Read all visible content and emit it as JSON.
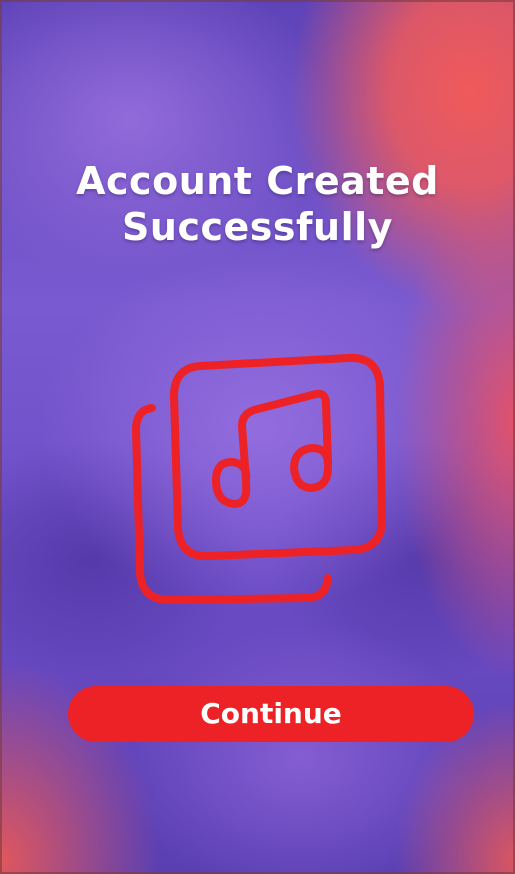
{
  "screen": {
    "title_line1": "Account Created",
    "title_line2": "Successfully",
    "icon": "music-note-gallery-icon",
    "continue_label": "Continue"
  },
  "colors": {
    "accent": "#ec2227",
    "text": "#ffffff",
    "background_primary": "#6a4fc4",
    "background_secondary": "#f05a5a"
  }
}
